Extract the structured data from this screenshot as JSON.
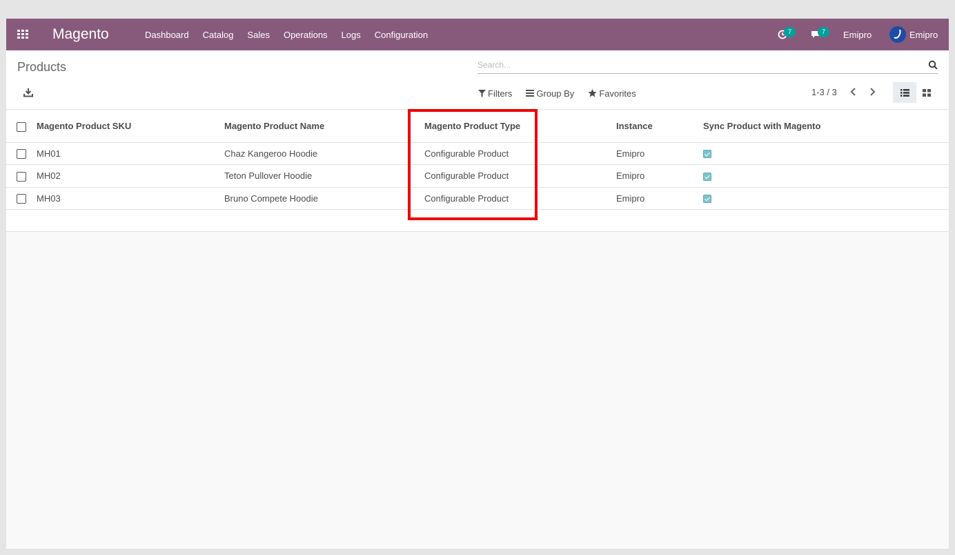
{
  "app": {
    "brand": "Magento",
    "menu": [
      "Dashboard",
      "Catalog",
      "Sales",
      "Operations",
      "Logs",
      "Configuration"
    ],
    "systray": {
      "activity_count": "7",
      "messages_count": "7",
      "company": "Emipro",
      "user": "Emipro"
    }
  },
  "control": {
    "title": "Products",
    "search_placeholder": "Search...",
    "filters_label": "Filters",
    "groupby_label": "Group By",
    "favorites_label": "Favorites",
    "pager": "1-3 / 3"
  },
  "table": {
    "columns": [
      "Magento Product SKU",
      "Magento Product Name",
      "Magento Product Type",
      "Instance",
      "Sync Product with Magento"
    ],
    "rows": [
      {
        "sku": "MH01",
        "name": "Chaz Kangeroo Hoodie",
        "type": "Configurable Product",
        "instance": "Emipro",
        "synced": true
      },
      {
        "sku": "MH02",
        "name": "Teton Pullover Hoodie",
        "type": "Configurable Product",
        "instance": "Emipro",
        "synced": true
      },
      {
        "sku": "MH03",
        "name": "Bruno Compete Hoodie",
        "type": "Configurable Product",
        "instance": "Emipro",
        "synced": true
      }
    ]
  },
  "colors": {
    "navbar": "#875a7b",
    "badge": "#00a09d",
    "highlight": "#ee0000"
  }
}
